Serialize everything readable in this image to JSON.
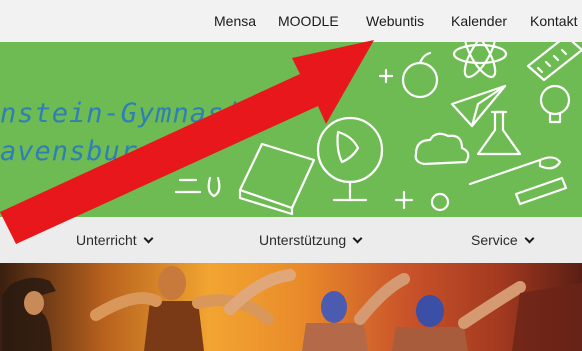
{
  "top_nav": {
    "items": [
      {
        "label": "Mensa"
      },
      {
        "label": "MOODLE"
      },
      {
        "label": "Webuntis"
      },
      {
        "label": "Kalender"
      },
      {
        "label": "Kontakt"
      }
    ]
  },
  "banner": {
    "line1": "nstein-Gymnasiu",
    "line2": "avensbur",
    "colors": {
      "background": "#6dbb52",
      "title": "#2f7fb6"
    }
  },
  "sub_nav": {
    "items": [
      {
        "label": "Unterricht"
      },
      {
        "label": "Unterstützung"
      },
      {
        "label": "Service"
      }
    ]
  },
  "icons": [
    "chevron-down-icon",
    "atom-icon",
    "apple-icon",
    "globe-icon",
    "book-icon",
    "paintbrush-icon",
    "flask-icon",
    "ruler-icon",
    "paper-plane-icon",
    "lightbulb-icon"
  ],
  "overlay": {
    "color": "#e8171b",
    "shape": "arrow"
  }
}
